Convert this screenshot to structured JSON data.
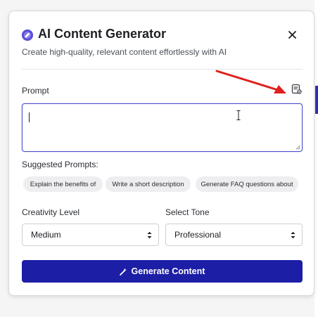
{
  "dialog": {
    "title": "AI Content Generator",
    "subtitle": "Create high-quality, relevant content effortlessly with AI",
    "close_icon": "close-icon",
    "header_icon": "sparkle-orb-icon"
  },
  "prompt": {
    "label": "Prompt",
    "value": "",
    "tool_icon": "template-list-icon"
  },
  "suggested": {
    "label": "Suggested Prompts:",
    "chips": [
      "Explain the benefits of",
      "Write a short description",
      "Generate FAQ questions about"
    ]
  },
  "creativity": {
    "label": "Creativity Level",
    "selected": "Medium"
  },
  "tone": {
    "label": "Select Tone",
    "selected": "Professional"
  },
  "generate": {
    "label": "Generate Content",
    "icon": "magic-wand-icon"
  },
  "colors": {
    "accent": "#1d1ea6",
    "focus_border": "#4d4fcf",
    "annotation_arrow": "#e0201b"
  }
}
